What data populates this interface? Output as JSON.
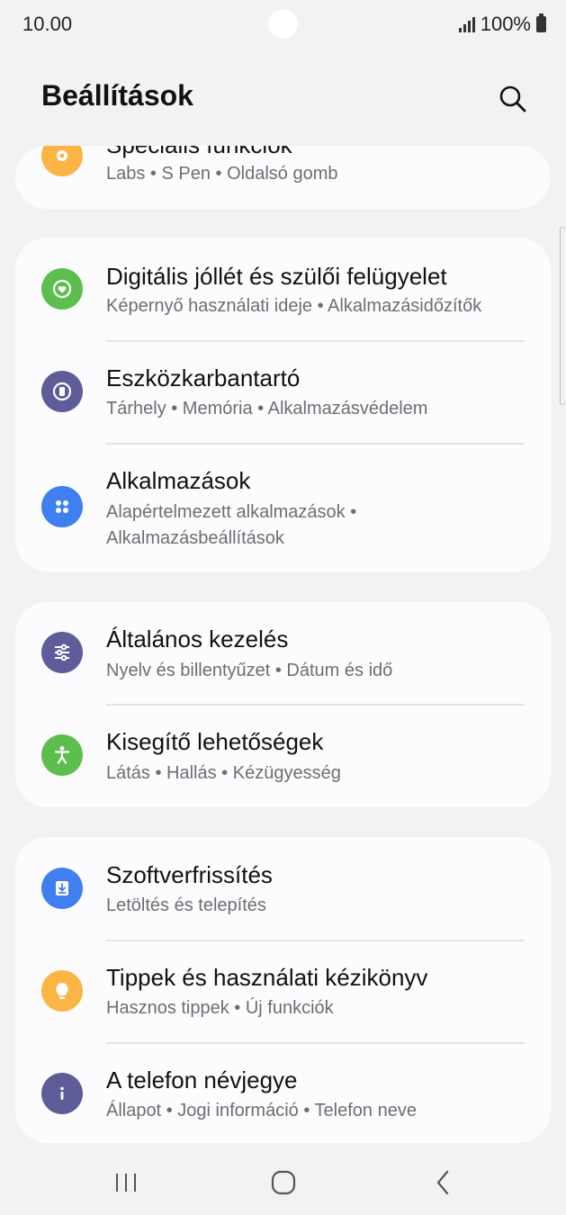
{
  "status_bar": {
    "time": "10.00",
    "battery": "100%"
  },
  "header": {
    "title": "Beállítások",
    "search_icon": "search-icon"
  },
  "colors": {
    "orange": "#fbb544",
    "green": "#5cbf4d",
    "purple": "#5e5c99",
    "blue": "#3f7ff0",
    "background": "#f2f2f4",
    "card": "#fcfcfe"
  },
  "groups": [
    {
      "items": [
        {
          "title": "Speciális funkciók",
          "subtitle": "Labs  •  S Pen  •  Oldalsó gomb",
          "icon": "puzzle-icon"
        }
      ]
    },
    {
      "items": [
        {
          "title": "Digitális jóllét és szülői felügyelet",
          "subtitle": "Képernyő használati ideje  •  Alkalmazásidőzítők",
          "icon": "heart-circle-icon"
        },
        {
          "title": "Eszközkarbantartó",
          "subtitle": "Tárhely  •  Memória  •  Alkalmazásvédelem",
          "icon": "device-care-icon"
        },
        {
          "title": "Alkalmazások",
          "subtitle": "Alapértelmezett alkalmazások  •  Alkalmazásbeállítások",
          "icon": "apps-grid-icon"
        }
      ]
    },
    {
      "items": [
        {
          "title": "Általános kezelés",
          "subtitle": "Nyelv és billentyűzet  •  Dátum és idő",
          "icon": "sliders-icon"
        },
        {
          "title": "Kisegítő lehetőségek",
          "subtitle": "Látás  •  Hallás  •  Kézügyesség",
          "icon": "accessibility-icon"
        }
      ]
    },
    {
      "items": [
        {
          "title": "Szoftverfrissítés",
          "subtitle": "Letöltés és telepítés",
          "icon": "download-icon"
        },
        {
          "title": "Tippek és használati kézikönyv",
          "subtitle": "Hasznos tippek  •  Új funkciók",
          "icon": "lightbulb-icon"
        },
        {
          "title": "A telefon névjegye",
          "subtitle": "Állapot  •  Jogi információ  •  Telefon neve",
          "icon": "info-icon"
        }
      ]
    }
  ],
  "nav_bar": {
    "recents_icon": "recents-icon",
    "home_icon": "home-icon",
    "back_icon": "back-icon"
  }
}
